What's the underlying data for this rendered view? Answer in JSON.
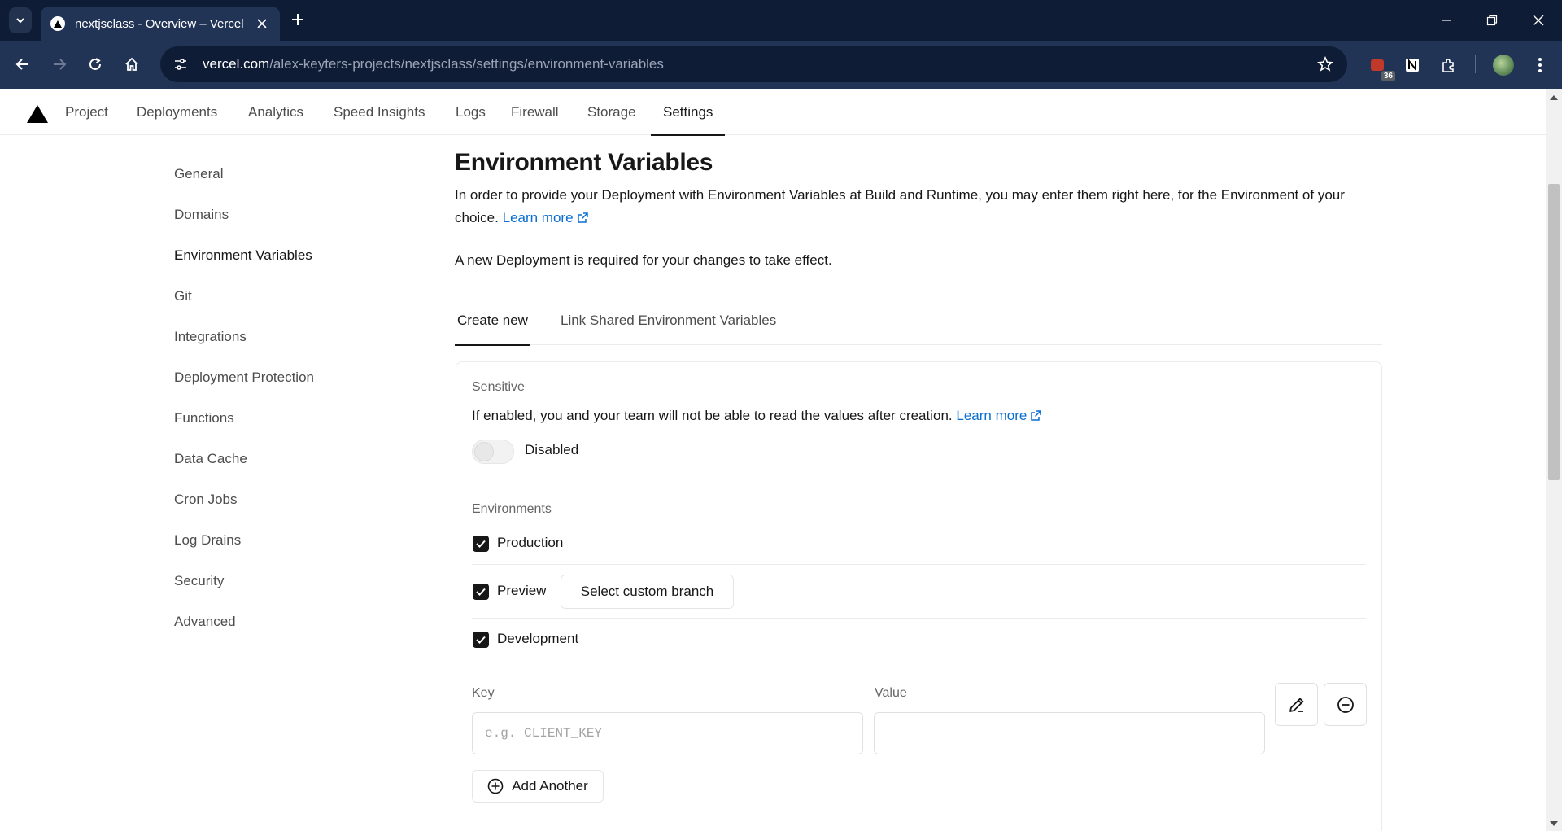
{
  "browser": {
    "tab_title": "nextjsclass - Overview – Vercel",
    "url_host": "vercel.com",
    "url_path": "/alex-keyters-projects/nextjsclass/settings/environment-variables",
    "extension_badge": "36"
  },
  "topnav": {
    "items": [
      "Project",
      "Deployments",
      "Analytics",
      "Speed Insights",
      "Logs",
      "Firewall",
      "Storage",
      "Settings"
    ],
    "active": "Settings"
  },
  "sidebar": {
    "items": [
      "General",
      "Domains",
      "Environment Variables",
      "Git",
      "Integrations",
      "Deployment Protection",
      "Functions",
      "Data Cache",
      "Cron Jobs",
      "Log Drains",
      "Security",
      "Advanced"
    ],
    "active": "Environment Variables"
  },
  "main": {
    "title": "Environment Variables",
    "description": "In order to provide your Deployment with Environment Variables at Build and Runtime, you may enter them right here, for the Environment of your choice.",
    "learn_more": "Learn more",
    "notice": "A new Deployment is required for your changes to take effect.",
    "tabs": [
      "Create new",
      "Link Shared Environment Variables"
    ],
    "sensitive": {
      "label": "Sensitive",
      "text": "If enabled, you and your team will not be able to read the values after creation.",
      "learn_more": "Learn more",
      "toggle_state": "Disabled"
    },
    "environments": {
      "label": "Environments",
      "production": "Production",
      "preview": "Preview",
      "custom_branch_button": "Select custom branch",
      "development": "Development"
    },
    "form": {
      "key_label": "Key",
      "value_label": "Value",
      "key_placeholder": "e.g. CLIENT_KEY",
      "value_placeholder": "",
      "add_another": "Add Another"
    }
  }
}
